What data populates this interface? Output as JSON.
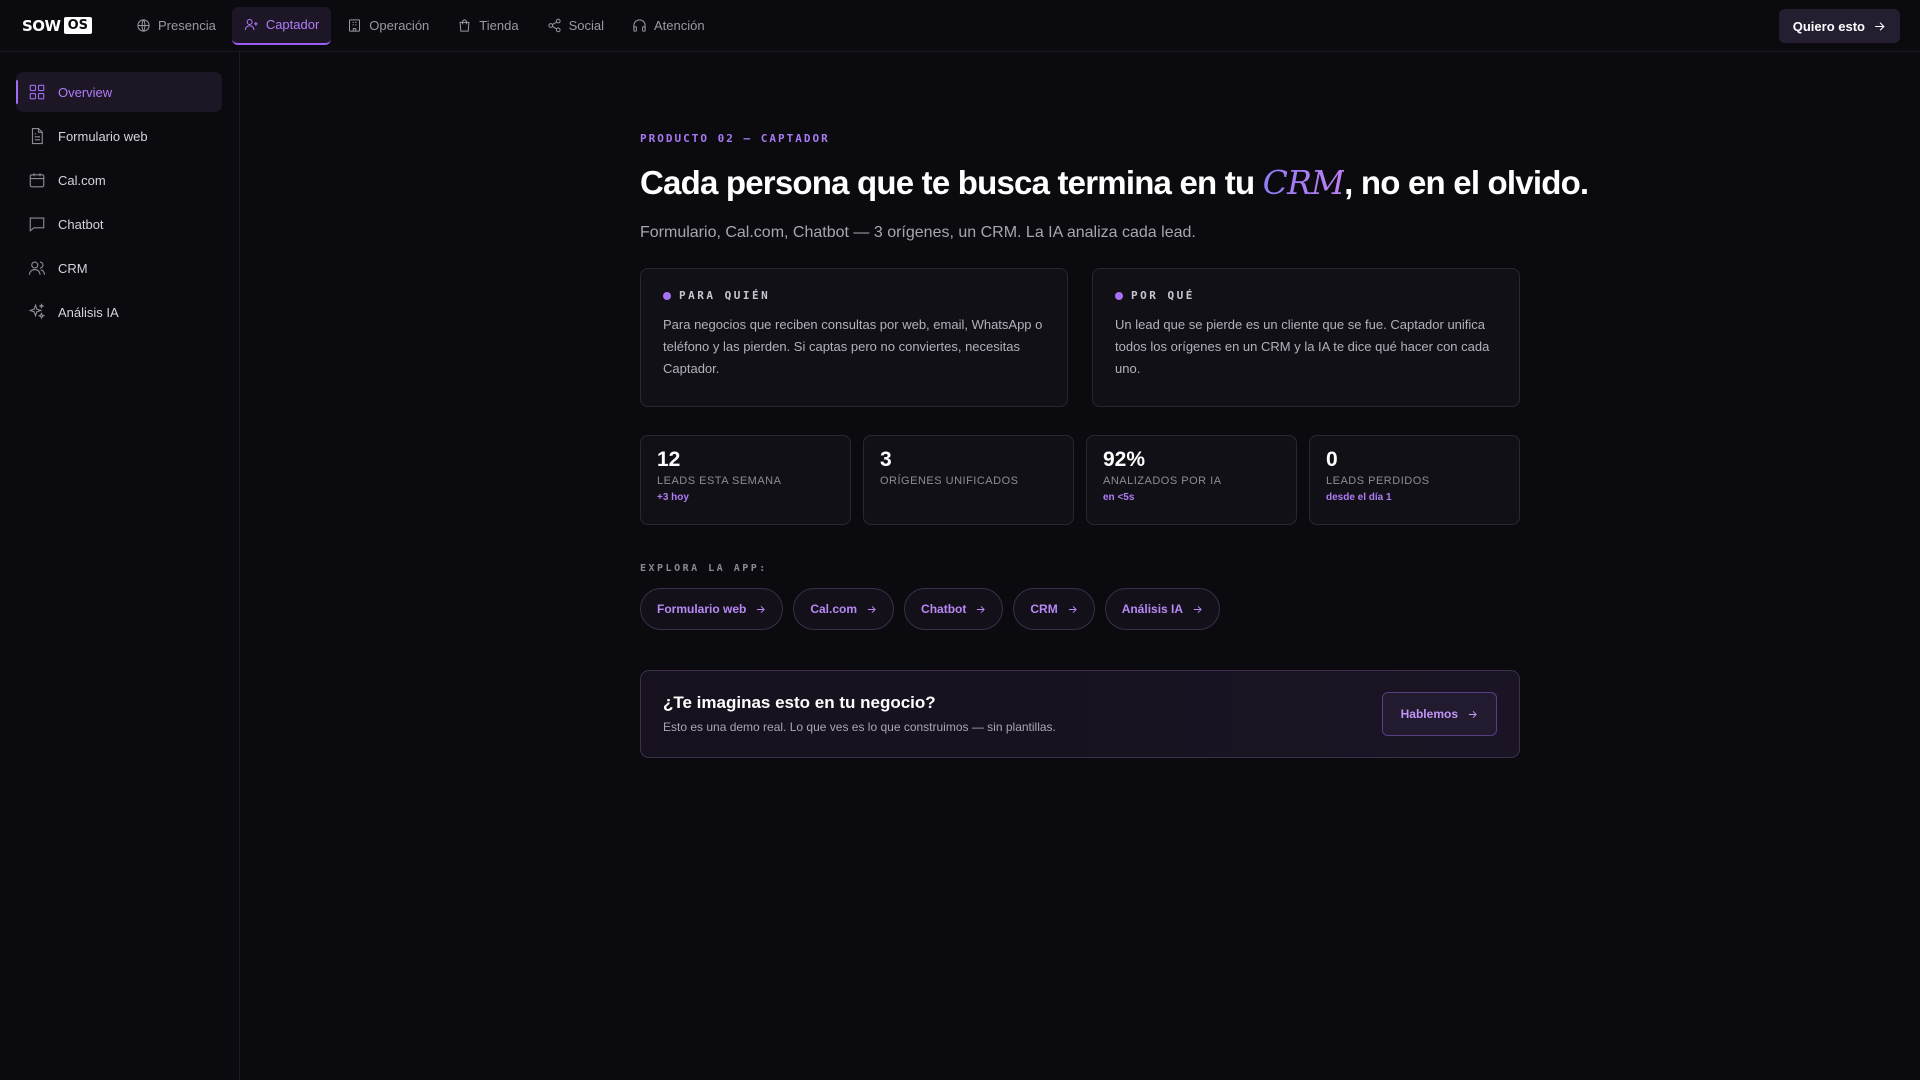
{
  "brand": {
    "logo_text": "SOW",
    "logo_box": "OS"
  },
  "topnav": {
    "items": [
      {
        "label": "Presencia",
        "icon": "globe-icon"
      },
      {
        "label": "Captador",
        "icon": "user-plus-icon",
        "active": true
      },
      {
        "label": "Operación",
        "icon": "building-icon"
      },
      {
        "label": "Tienda",
        "icon": "shopping-bag-icon"
      },
      {
        "label": "Social",
        "icon": "share-icon"
      },
      {
        "label": "Atención",
        "icon": "headphones-icon"
      }
    ],
    "cta_label": "Quiero esto"
  },
  "sidebar": {
    "items": [
      {
        "label": "Overview",
        "icon": "grid-icon",
        "active": true
      },
      {
        "label": "Formulario web",
        "icon": "document-icon"
      },
      {
        "label": "Cal.com",
        "icon": "calendar-icon"
      },
      {
        "label": "Chatbot",
        "icon": "chat-icon"
      },
      {
        "label": "CRM",
        "icon": "users-icon"
      },
      {
        "label": "Análisis IA",
        "icon": "sparkles-icon"
      }
    ]
  },
  "main": {
    "eyebrow": "PRODUCTO 02 — CAPTADOR",
    "headline": {
      "before": "Cada persona que te busca termina en tu ",
      "highlight": "CRM",
      "after": ", no en el olvido."
    },
    "subhead": "Formulario, Cal.com, Chatbot — 3 orígenes, un CRM. La IA analiza cada lead.",
    "cards": [
      {
        "title": "PARA QUIÉN",
        "body": "Para negocios que reciben consultas por web, email, WhatsApp o teléfono y las pierden. Si captas pero no conviertes, necesitas Captador."
      },
      {
        "title": "POR QUÉ",
        "body": "Un lead que se pierde es un cliente que se fue. Captador unifica todos los orígenes en un CRM y la IA te dice qué hacer con cada uno."
      }
    ],
    "stats": [
      {
        "value": "12",
        "label": "LEADS ESTA SEMANA",
        "sub": "+3 hoy"
      },
      {
        "value": "3",
        "label": "ORÍGENES UNIFICADOS",
        "sub": ""
      },
      {
        "value": "92%",
        "label": "ANALIZADOS POR IA",
        "sub": "en <5s"
      },
      {
        "value": "0",
        "label": "LEADS PERDIDOS",
        "sub": "desde el día 1"
      }
    ],
    "explore_label": "EXPLORA LA APP:",
    "chips": [
      "Formulario web",
      "Cal.com",
      "Chatbot",
      "CRM",
      "Análisis IA"
    ],
    "banner": {
      "title": "¿Te imaginas esto en tu negocio?",
      "text": "Esto es una demo real. Lo que ves es lo que construimos — sin plantillas.",
      "button_label": "Hablemos"
    }
  },
  "colors": {
    "background": "#0b0a0e",
    "accent": "#a671f2",
    "card": "#121017",
    "border": "#2a2732"
  }
}
